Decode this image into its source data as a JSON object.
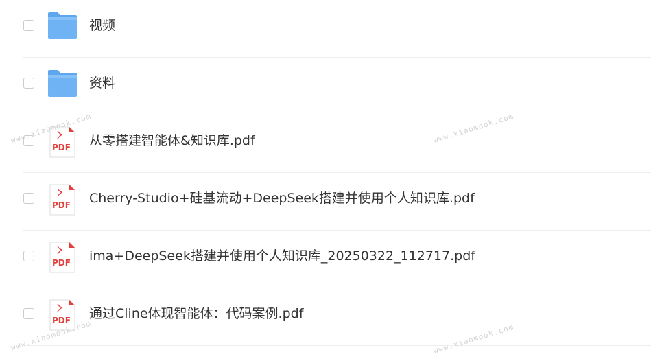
{
  "files": [
    {
      "name": "视频",
      "icon": "folder-icon"
    },
    {
      "name": "资料",
      "icon": "folder-icon"
    },
    {
      "name": "从零搭建智能体&知识库.pdf",
      "icon": "pdf-icon"
    },
    {
      "name": "Cherry-Studio+硅基流动+DeepSeek搭建并使用个人知识库.pdf",
      "icon": "pdf-icon"
    },
    {
      "name": "ima+DeepSeek搭建并使用个人知识库_20250322_112717.pdf",
      "icon": "pdf-icon"
    },
    {
      "name": "通过Cline体现智能体：代码案例.pdf",
      "icon": "pdf-icon"
    }
  ],
  "pdf_icon_label": "PDF",
  "watermark": "www.xiaomook.com",
  "colors": {
    "folder": "#6fb3f4",
    "folder_tab": "#5ea6ee",
    "pdf_red": "#e2403c",
    "text": "#333333",
    "divider": "#eeeeee"
  }
}
